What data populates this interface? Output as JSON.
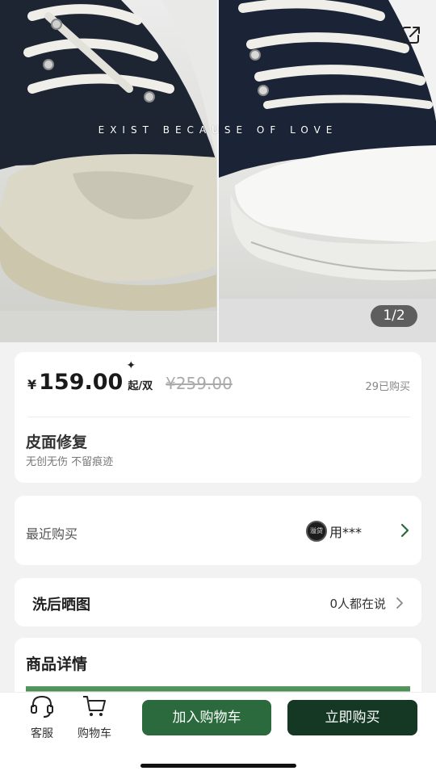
{
  "hero": {
    "tagline": "EXIST BECAUSE OF LOVE",
    "counter": "1/2",
    "share_icon": "share-icon"
  },
  "price_card": {
    "currency": "¥",
    "price": "159.00",
    "sparkle": "✦",
    "unit": "起/双",
    "original_price": "¥259.00",
    "sold": "29已购买",
    "service_title": "皮面修复",
    "service_subtitle": "无创无伤 不留痕迹"
  },
  "recent": {
    "label": "最近购买",
    "buyer_name": "用***",
    "avatar_text": "溢贷"
  },
  "show": {
    "title": "洗后晒图",
    "count": "0人都在说"
  },
  "details": {
    "title": "商品详情"
  },
  "bottom": {
    "customer_service": "客服",
    "cart": "购物车",
    "add_to_cart": "加入购物车",
    "buy_now": "立即购买"
  },
  "colors": {
    "primary_green": "#2b6a3c",
    "dark_green": "#143824",
    "background": "#f2f2f2"
  }
}
